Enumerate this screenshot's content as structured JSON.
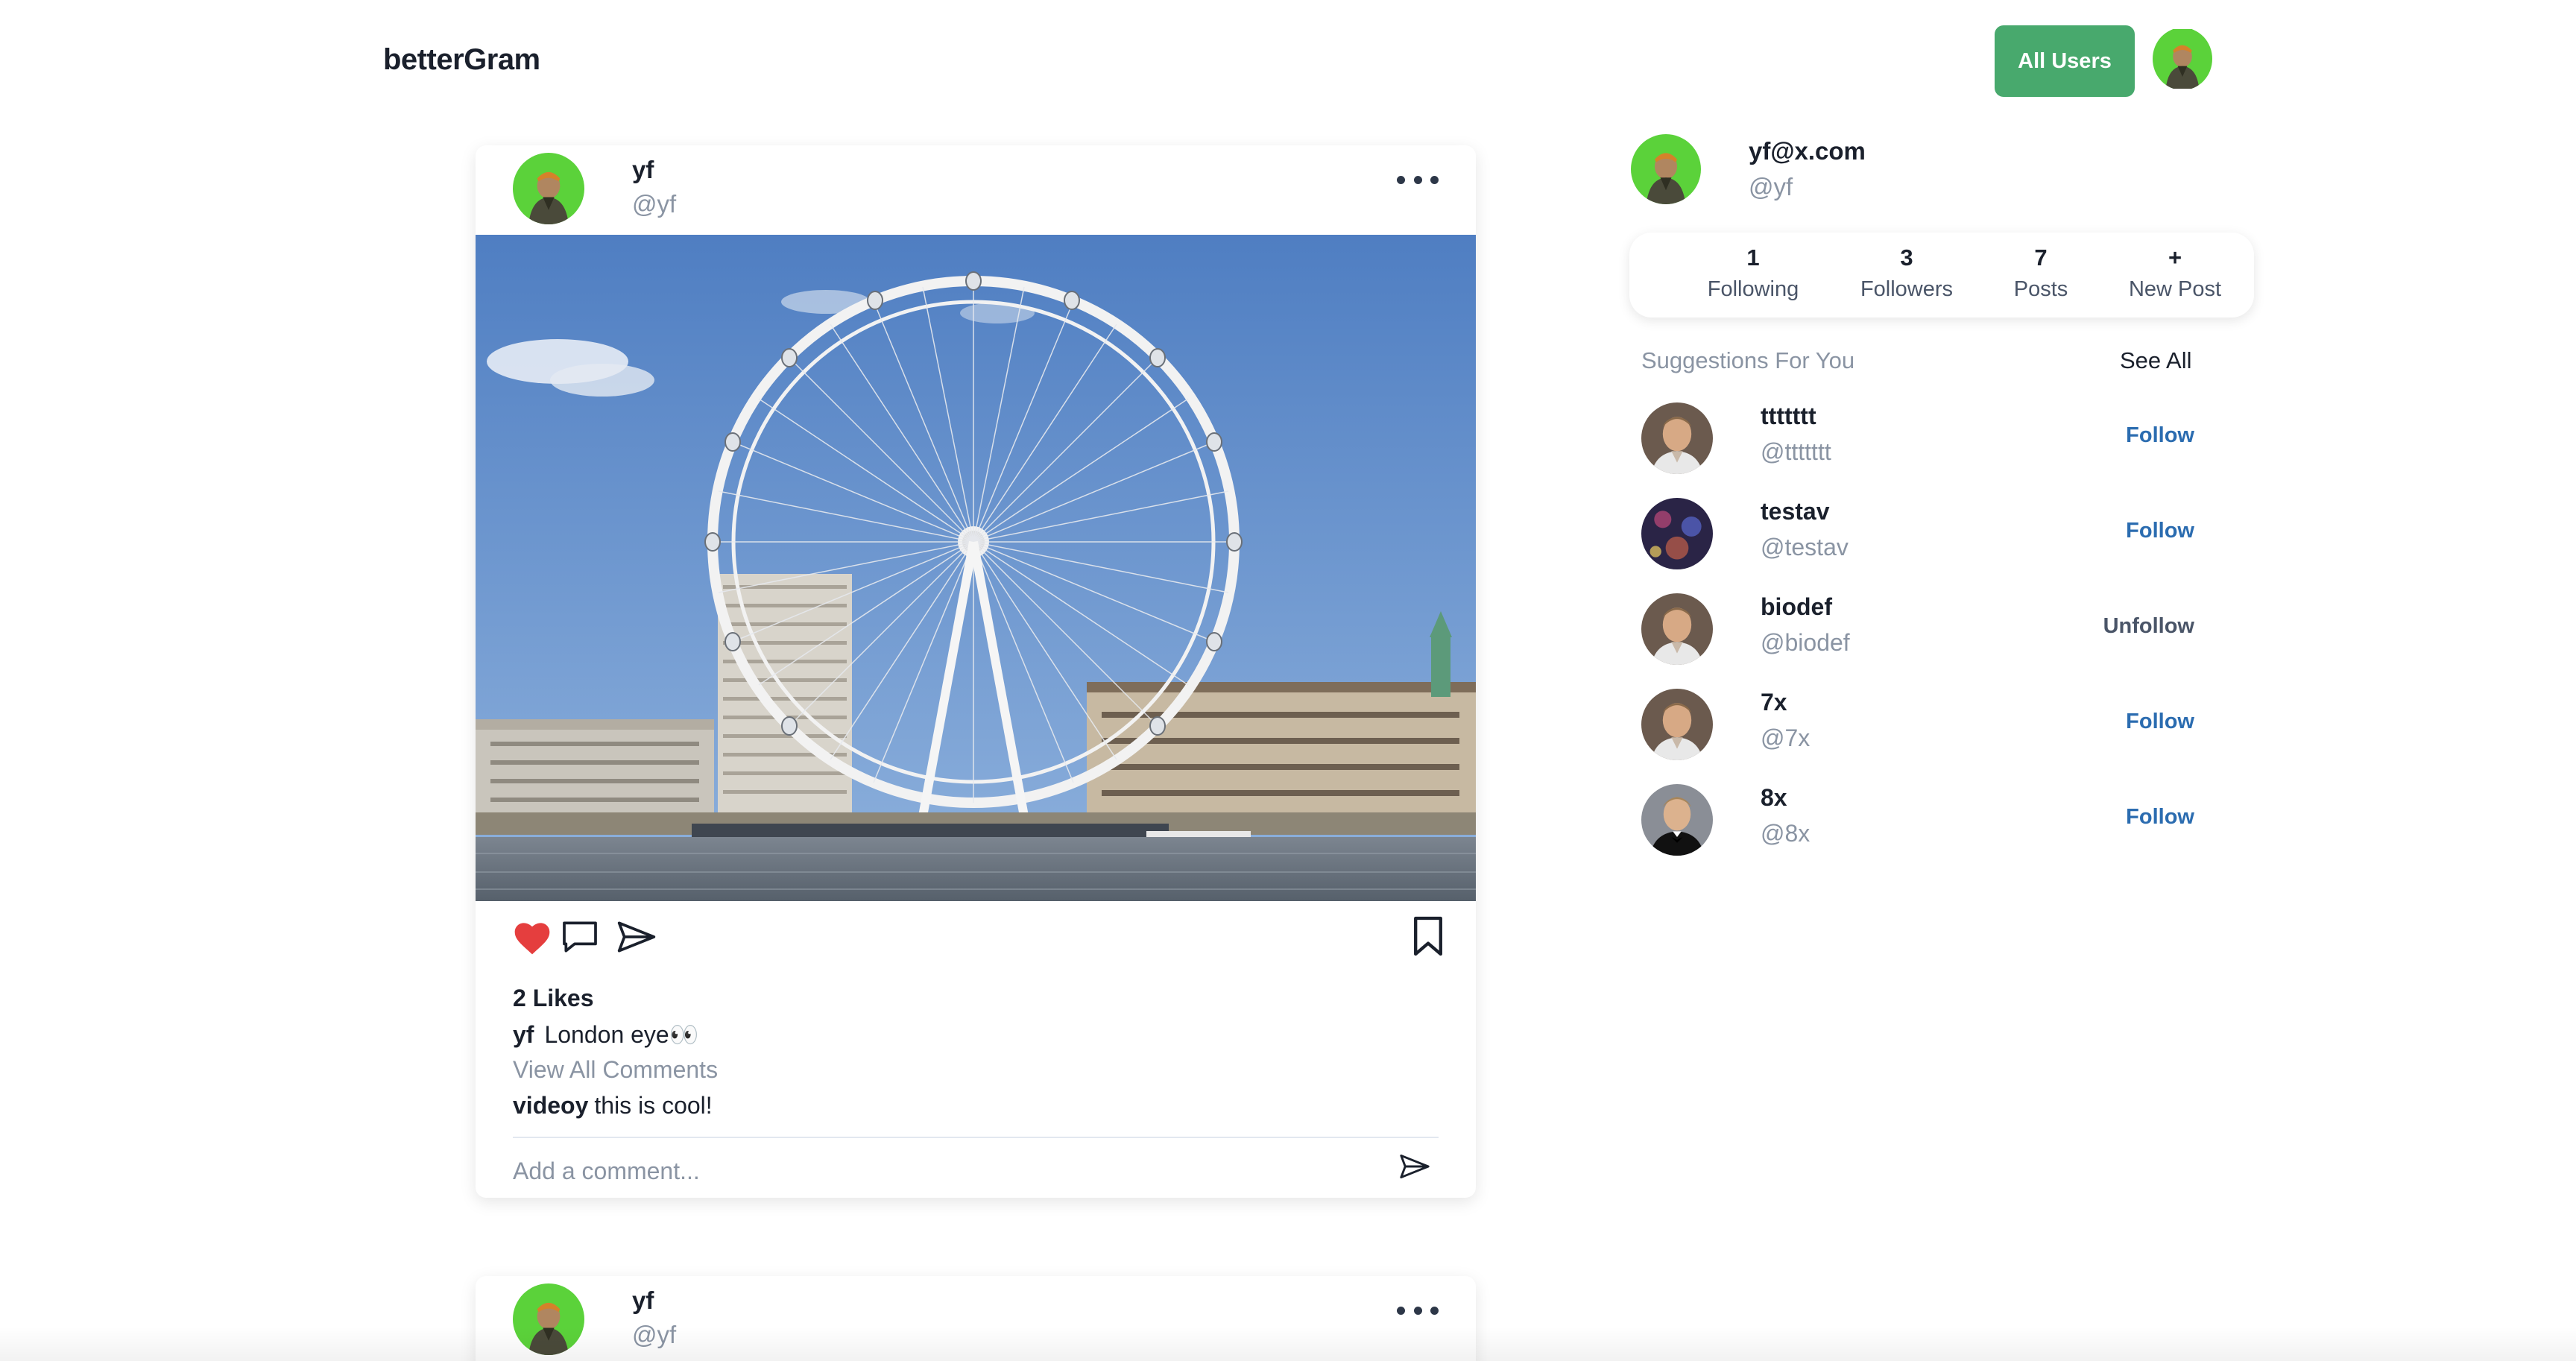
{
  "header": {
    "brand": "betterGram",
    "all_users_label": "All Users",
    "avatar_icon": "user-avatar-icon"
  },
  "posts": [
    {
      "author_name": "yf",
      "author_handle": "@yf",
      "image_desc_icon": "photo-icon",
      "likes": "2 Likes",
      "caption_user": "yf",
      "caption_text": "London eye👀",
      "view_all": "View All Comments",
      "comment_user": "videoy",
      "comment_text": "this is cool!",
      "comment_placeholder": "Add a comment..."
    },
    {
      "author_name": "yf",
      "author_handle": "@yf"
    }
  ],
  "profile": {
    "email": "yf@x.com",
    "handle": "@yf",
    "stats": [
      {
        "value": "1",
        "label": "Following"
      },
      {
        "value": "3",
        "label": "Followers"
      },
      {
        "value": "7",
        "label": "Posts"
      },
      {
        "value": "+",
        "label": "New Post"
      }
    ]
  },
  "suggestions": {
    "title": "Suggestions For You",
    "see_all": "See All",
    "users": [
      {
        "name": "ttttttt",
        "handle": "@ttttttt",
        "action": "Follow"
      },
      {
        "name": "testav",
        "handle": "@testav",
        "action": "Follow"
      },
      {
        "name": "biodef",
        "handle": "@biodef",
        "action": "Unfollow"
      },
      {
        "name": "7x",
        "handle": "@7x",
        "action": "Follow"
      },
      {
        "name": "8x",
        "handle": "@8x",
        "action": "Follow"
      }
    ]
  },
  "colors": {
    "accent_green": "#48a96d",
    "follow_blue": "#2b6cb0",
    "like_red": "#e53e3e",
    "muted_gray": "#8a94a3"
  }
}
